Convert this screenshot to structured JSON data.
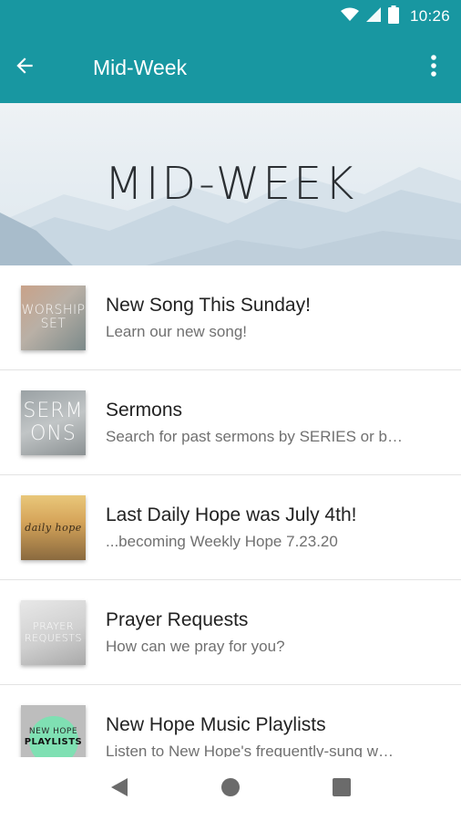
{
  "status_bar": {
    "time": "10:26",
    "icons": [
      "wifi-icon",
      "cell-signal-icon",
      "battery-icon"
    ]
  },
  "app_bar": {
    "title": "Mid-Week",
    "back_icon": "arrow-back-icon",
    "menu_icon": "more-vert-icon"
  },
  "banner": {
    "title": "MID-WEEK"
  },
  "list": {
    "items": [
      {
        "title": "New Song This Sunday!",
        "subtitle": "Learn our new song!",
        "thumb_text": [
          "WORSHIP",
          "SET"
        ]
      },
      {
        "title": "Sermons",
        "subtitle": "Search for past sermons by SERIES or b…",
        "thumb_text": [
          "SERM",
          "ONS"
        ]
      },
      {
        "title": "Last Daily Hope was July 4th!",
        "subtitle": "...becoming Weekly Hope 7.23.20",
        "thumb_text": [
          "daily hope"
        ]
      },
      {
        "title": "Prayer Requests",
        "subtitle": "How can we pray for you?",
        "thumb_text": [
          "PRAYER",
          "REQUESTS"
        ]
      },
      {
        "title": "New Hope Music Playlists",
        "subtitle": "Listen to New Hope's frequently-sung w…",
        "thumb_text": [
          "NEW HOPE",
          "PLAYLISTS"
        ]
      }
    ]
  },
  "nav_bar": {
    "icons": [
      "back-triangle-icon",
      "home-circle-icon",
      "recents-square-icon"
    ]
  },
  "colors": {
    "accent": "#1897a1"
  }
}
